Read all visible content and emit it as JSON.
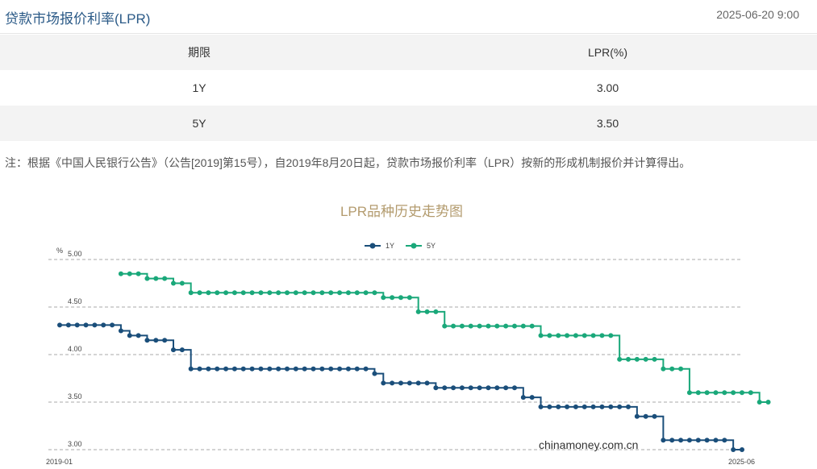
{
  "header": {
    "title": "贷款市场报价利率(LPR)",
    "time": "2025-06-20 9:00"
  },
  "table": {
    "headers": [
      "期限",
      "LPR(%)"
    ],
    "rows": [
      [
        "1Y",
        "3.00"
      ],
      [
        "5Y",
        "3.50"
      ]
    ]
  },
  "note": "注：根据《中国人民银行公告》（公告[2019]第15号），自2019年8月20日起，贷款市场报价利率（LPR）按新的形成机制报价并计算得出。",
  "chart_data": {
    "type": "line",
    "title": "LPR品种历史走势图",
    "ylabel": "%",
    "ylim": [
      3.0,
      5.0
    ],
    "yticks": [
      "5.00",
      "4.50",
      "4.00",
      "3.50",
      "3.00"
    ],
    "x_start_label": "2019-01",
    "x_end_label": "2025-06",
    "grid": true,
    "legend_position": "top-center",
    "watermark": "chinamoney.com.cn",
    "colors": {
      "1Y": "#1a4e7a",
      "5Y": "#1aa87a"
    },
    "series": [
      {
        "name": "1Y",
        "values": [
          4.31,
          4.31,
          4.31,
          4.31,
          4.31,
          4.31,
          4.31,
          4.25,
          4.2,
          4.2,
          4.15,
          4.15,
          4.15,
          4.05,
          4.05,
          3.85,
          3.85,
          3.85,
          3.85,
          3.85,
          3.85,
          3.85,
          3.85,
          3.85,
          3.85,
          3.85,
          3.85,
          3.85,
          3.85,
          3.85,
          3.85,
          3.85,
          3.85,
          3.85,
          3.85,
          3.85,
          3.8,
          3.7,
          3.7,
          3.7,
          3.7,
          3.7,
          3.7,
          3.65,
          3.65,
          3.65,
          3.65,
          3.65,
          3.65,
          3.65,
          3.65,
          3.65,
          3.65,
          3.55,
          3.55,
          3.45,
          3.45,
          3.45,
          3.45,
          3.45,
          3.45,
          3.45,
          3.45,
          3.45,
          3.45,
          3.45,
          3.35,
          3.35,
          3.35,
          3.1,
          3.1,
          3.1,
          3.1,
          3.1,
          3.1,
          3.1,
          3.1,
          3.0,
          3.0
        ]
      },
      {
        "name": "5Y",
        "values": [
          null,
          null,
          null,
          null,
          null,
          null,
          null,
          4.85,
          4.85,
          4.85,
          4.8,
          4.8,
          4.8,
          4.75,
          4.75,
          4.65,
          4.65,
          4.65,
          4.65,
          4.65,
          4.65,
          4.65,
          4.65,
          4.65,
          4.65,
          4.65,
          4.65,
          4.65,
          4.65,
          4.65,
          4.65,
          4.65,
          4.65,
          4.65,
          4.65,
          4.65,
          4.65,
          4.6,
          4.6,
          4.6,
          4.6,
          4.45,
          4.45,
          4.45,
          4.3,
          4.3,
          4.3,
          4.3,
          4.3,
          4.3,
          4.3,
          4.3,
          4.3,
          4.3,
          4.3,
          4.2,
          4.2,
          4.2,
          4.2,
          4.2,
          4.2,
          4.2,
          4.2,
          4.2,
          3.95,
          3.95,
          3.95,
          3.95,
          3.95,
          3.85,
          3.85,
          3.85,
          3.6,
          3.6,
          3.6,
          3.6,
          3.6,
          3.6,
          3.6,
          3.6,
          3.5,
          3.5
        ]
      }
    ]
  }
}
